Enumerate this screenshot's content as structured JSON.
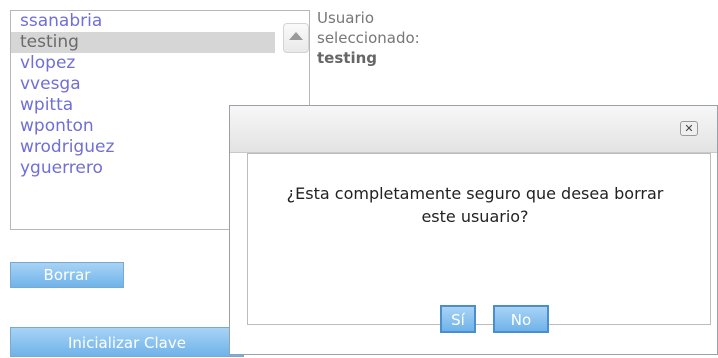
{
  "users": {
    "items": [
      "ssanabria",
      "testing",
      "vlopez",
      "vvesga",
      "wpitta",
      "wponton",
      "wrodriguez",
      "yguerrero"
    ],
    "selected_index": 1
  },
  "selection": {
    "label_line1": "Usuario",
    "label_line2": "seleccionado:",
    "value": "testing"
  },
  "actions": {
    "delete_label": "Borrar",
    "reset_password_label": "Inicializar Clave"
  },
  "dialog": {
    "message_line1": "¿Esta completamente seguro que desea borrar",
    "message_line2": "este usuario?",
    "yes_label": "Sí",
    "no_label": "No",
    "close_glyph": "✕"
  },
  "colors": {
    "link_blue": "#6f6fd6",
    "button_blue": "#6fb3ea"
  }
}
